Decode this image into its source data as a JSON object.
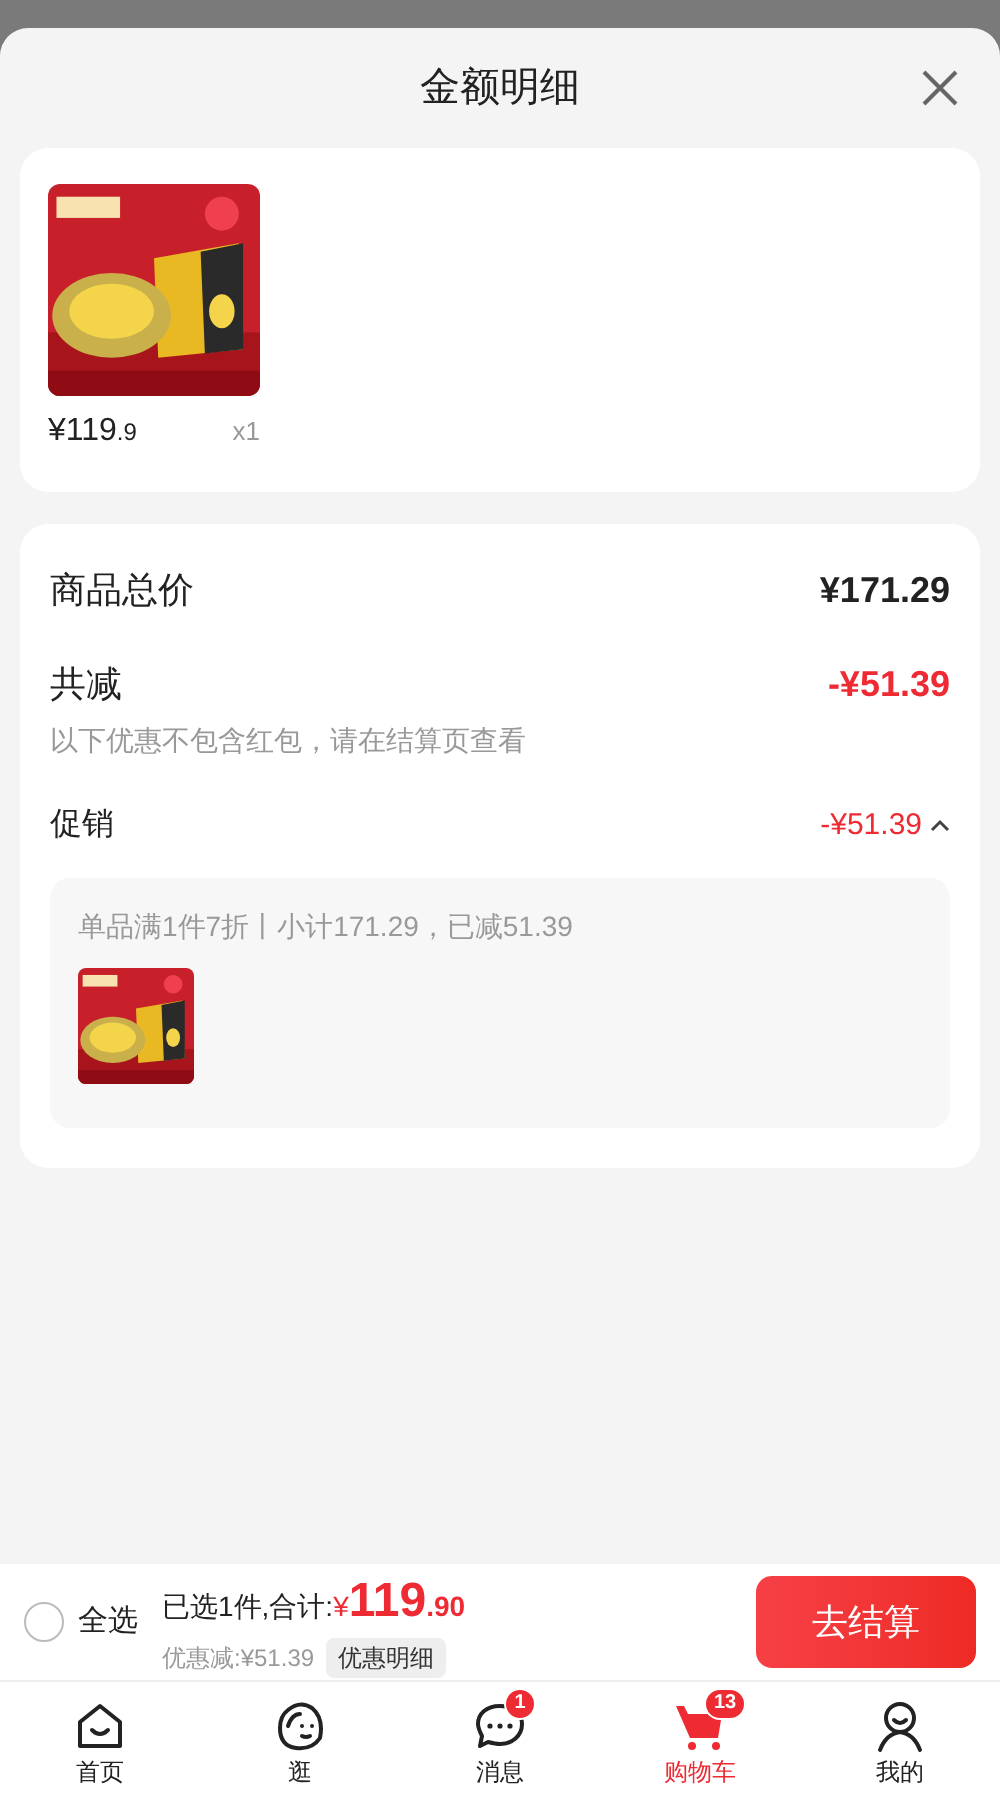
{
  "sheet": {
    "title": "金额明细"
  },
  "product": {
    "kind": "picture",
    "price_main": "¥119",
    "price_decimal": ".9",
    "quantity": "x1"
  },
  "summary": {
    "total_label": "商品总价",
    "total_value": "¥171.29",
    "discount_label": "共减",
    "discount_value": "-¥51.39",
    "discount_note": "以下优惠不包含红包，请在结算页查看",
    "promo_label": "促销",
    "promo_value": "-¥51.39",
    "promo_expanded": true,
    "promo_detail": {
      "text": "单品满1件7折丨小计171.29，已减51.39"
    }
  },
  "checkout_bar": {
    "select_all": {
      "label": "全选",
      "checked": false
    },
    "selected_text": "已选1件,合计:",
    "currency": "¥",
    "amount_main": "119",
    "amount_decimal": ".90",
    "saved_text": "优惠减:¥51.39",
    "details_button": "优惠明细",
    "checkout_button": "去结算"
  },
  "tab_bar": [
    {
      "label": "首页",
      "kind": "home",
      "selected": false
    },
    {
      "label": "逛",
      "kind": "browse",
      "selected": false
    },
    {
      "label": "消息",
      "kind": "messages",
      "selected": false,
      "badge": "1"
    },
    {
      "label": "购物车",
      "kind": "cart",
      "selected": true,
      "badge": "13"
    },
    {
      "label": "我的",
      "kind": "profile",
      "selected": false
    }
  ]
}
